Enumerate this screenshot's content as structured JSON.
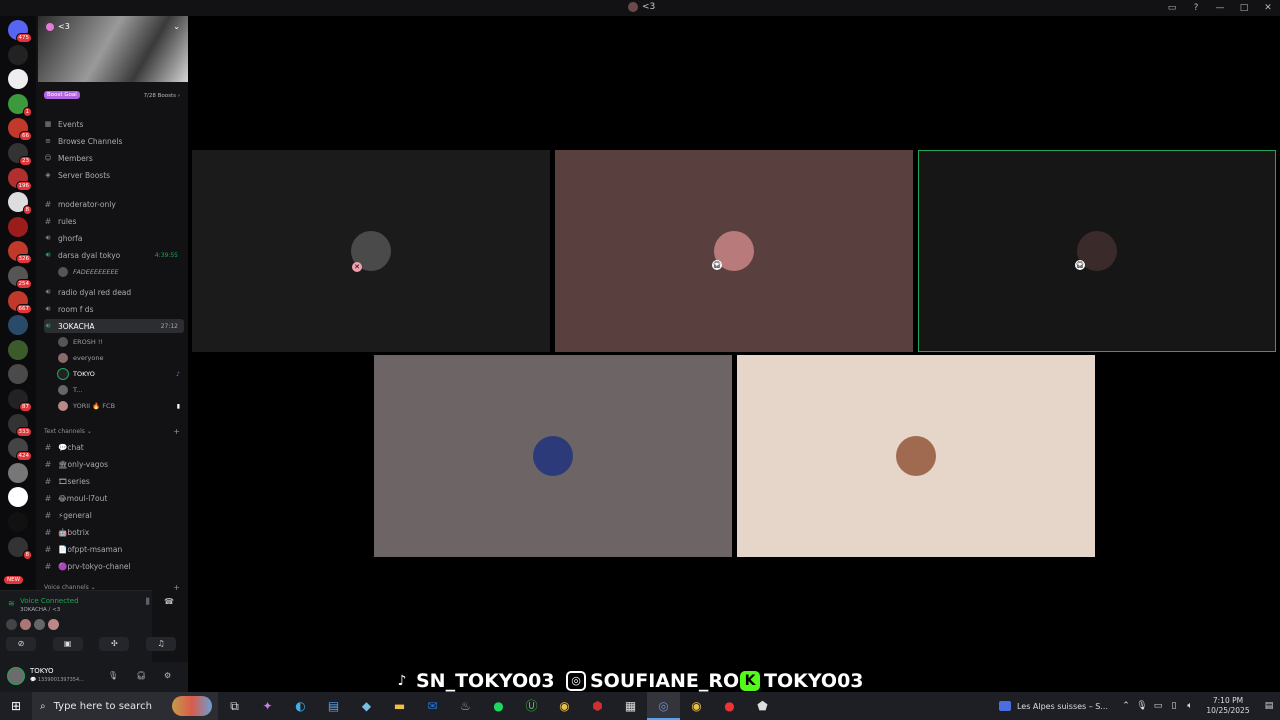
{
  "window": {
    "title": "<3",
    "controls": [
      "▭",
      "?",
      "—",
      "□",
      "✕"
    ]
  },
  "rail": {
    "servers": [
      {
        "icon": "discord-home-icon",
        "color": "#5865f2",
        "badge": "475"
      },
      {
        "icon": "server-icon",
        "color": "#222",
        "badge": ""
      },
      {
        "icon": "server-icon",
        "color": "#eee",
        "badge": ""
      },
      {
        "icon": "server-icon",
        "color": "#3c9a3c",
        "badge": "1"
      },
      {
        "icon": "server-icon",
        "color": "#c0392b",
        "badge": "66"
      },
      {
        "icon": "server-icon",
        "color": "#333",
        "badge": "23"
      },
      {
        "icon": "server-icon",
        "color": "#b03030",
        "badge": "196"
      },
      {
        "icon": "server-icon",
        "color": "#ddd",
        "badge": "8"
      },
      {
        "icon": "server-icon",
        "color": "#9b1c1c",
        "badge": ""
      },
      {
        "icon": "server-icon",
        "color": "#c0392b",
        "badge": "326"
      },
      {
        "icon": "server-icon",
        "color": "#555",
        "badge": "254"
      },
      {
        "icon": "server-icon",
        "color": "#c0392b",
        "badge": "667"
      },
      {
        "icon": "server-icon",
        "color": "#2a4a6a",
        "badge": ""
      },
      {
        "icon": "server-icon",
        "color": "#3b5b2b",
        "badge": ""
      },
      {
        "icon": "server-icon",
        "color": "#4a4a4a",
        "badge": ""
      },
      {
        "icon": "server-icon",
        "color": "#222",
        "badge": "87"
      },
      {
        "icon": "server-icon",
        "color": "#333",
        "badge": "333"
      },
      {
        "icon": "server-icon",
        "color": "#444",
        "badge": "424"
      },
      {
        "icon": "server-icon",
        "color": "#777",
        "badge": ""
      },
      {
        "icon": "server-icon",
        "color": "#fff",
        "badge": ""
      },
      {
        "icon": "server-icon",
        "color": "#111",
        "badge": ""
      },
      {
        "icon": "server-icon",
        "color": "#333",
        "badge": "8"
      }
    ],
    "new_label": "NEW"
  },
  "server": {
    "name": "<3",
    "boost_goal": "Boost Goal",
    "boost_count": "7/28 Boosts ›",
    "nav": [
      {
        "label": "Events",
        "icon": "calendar-icon"
      },
      {
        "label": "Browse Channels",
        "icon": "browse-channels-icon"
      },
      {
        "label": "Members",
        "icon": "members-icon"
      },
      {
        "label": "Server Boosts",
        "icon": "boost-icon"
      }
    ],
    "channels_top": [
      {
        "label": "moderator-only",
        "type": "text"
      },
      {
        "label": "rules",
        "type": "text"
      },
      {
        "label": "ghorfa",
        "type": "voice"
      },
      {
        "label": "darsa dyal tokyo",
        "type": "voice",
        "time": "4:39:55"
      }
    ],
    "darsa_user": "FADEEEEEEEE",
    "channels_mid": [
      {
        "label": "radio dyal red dead",
        "type": "voice"
      },
      {
        "label": "room f ds",
        "type": "voice"
      },
      {
        "label": "3OKACHA",
        "type": "voice",
        "time": "27:12"
      }
    ],
    "voice_users": [
      {
        "name": "EROSH !!",
        "tag": ""
      },
      {
        "name": "everyone",
        "tag": ""
      },
      {
        "name": "TOKYO",
        "tag": "♪"
      },
      {
        "name": "T...",
        "tag": ""
      },
      {
        "name": "YORII 🔥 FCB",
        "tag": ""
      }
    ],
    "text_section": "Text channels ⌄",
    "text_channels": [
      "💬chat",
      "🏛only-vagos",
      "🎞series",
      "😂moul-l7out",
      "⚡general",
      "🤖botrix",
      "📄ofppt-msaman",
      "🟣prv-tokyo-chanel"
    ],
    "voice_section": "Voice channels ⌄"
  },
  "voice_panel": {
    "status": "Voice Connected",
    "location": "3OKACHA / <3"
  },
  "account": {
    "name": "TOKYO",
    "status": "💬 1339001397354..."
  },
  "stage": {
    "tiles": [
      {
        "bg": "#1b1b1b",
        "avatar": "#4a4a4a",
        "speaking": false,
        "muted": true
      },
      {
        "bg": "#5a3f3f",
        "avatar": "#b87a7a",
        "speaking": false,
        "muted": true
      },
      {
        "bg": "#161616",
        "avatar": "#3a2a2a",
        "speaking": true,
        "muted": true
      },
      {
        "bg": "#6d6465",
        "avatar": "#2c3a7a",
        "speaking": false,
        "muted": false
      },
      {
        "bg": "#e6d6c9",
        "avatar": "#a06a50",
        "speaking": false,
        "muted": false
      }
    ]
  },
  "overlay": {
    "tiktok": "SN_TOKYO03",
    "instagram": "SOUFIANE_RO",
    "kick": "TOKYO03"
  },
  "taskbar": {
    "search_placeholder": "Type here to search",
    "news": "Les Alpes suisses – S...",
    "time": "7:10 PM",
    "date": "10/25/2025"
  }
}
